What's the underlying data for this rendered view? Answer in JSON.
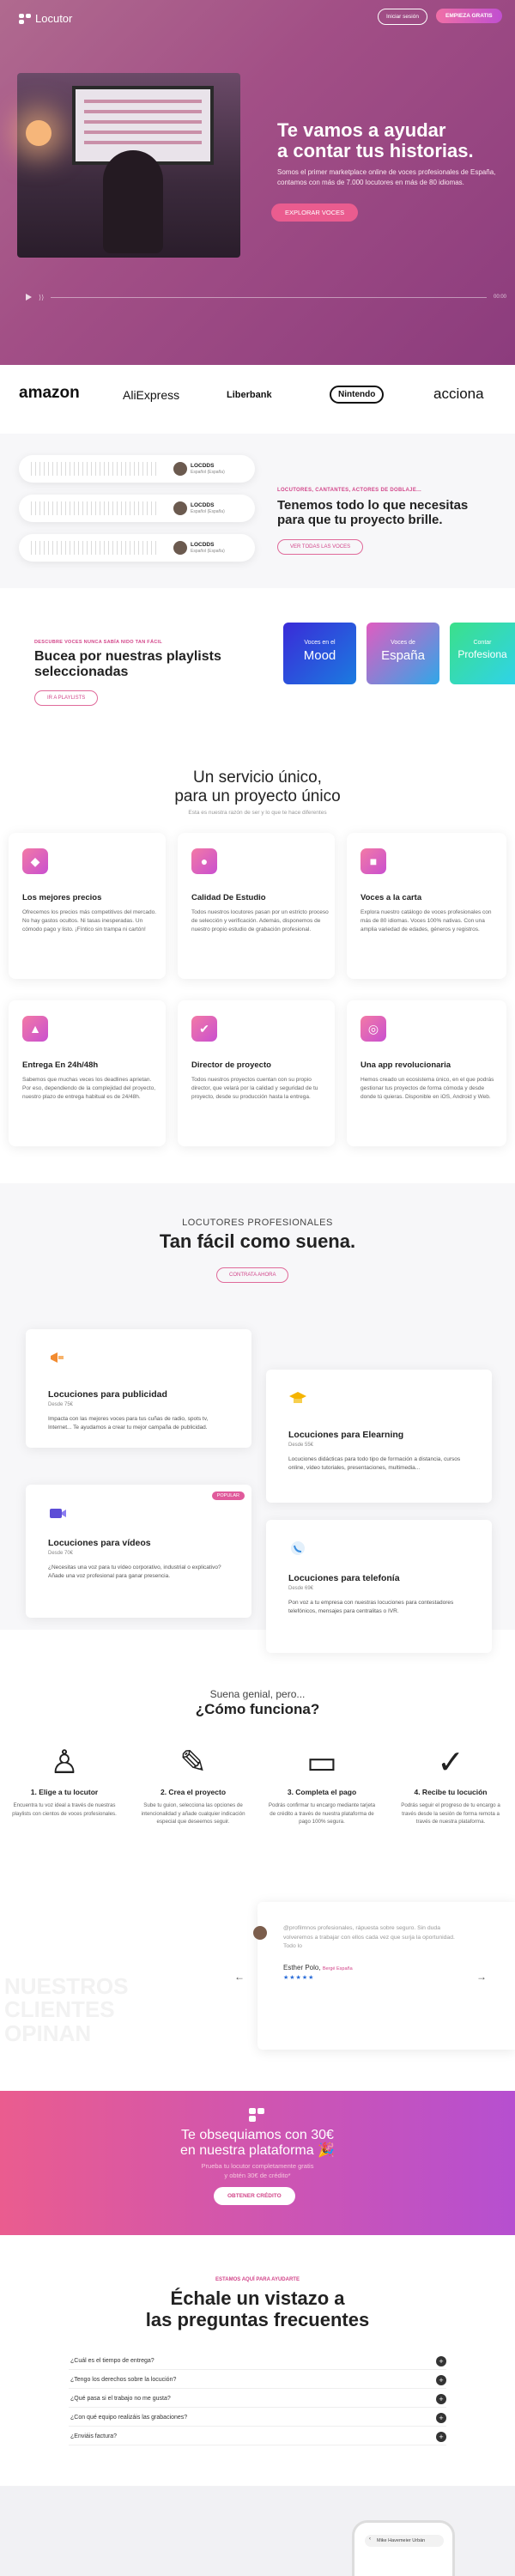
{
  "header": {
    "brand": "Locutor",
    "login_label": "Iniciar sesión",
    "cta_label": "EMPIEZA GRATIS"
  },
  "hero": {
    "title_line1": "Te vamos a ayudar",
    "title_line2": "a contar tus historias.",
    "subtitle_line1": "Somos el primer marketplace online de voces profesionales de España,",
    "subtitle_line2": "contamos con más de 7.000 locutores en más de 80 idiomas.",
    "cta_label": "EXPLORAR VOCES"
  },
  "brands": [
    "amazon",
    "AliExpress",
    "Liberbank",
    "Nintendo",
    "acciona"
  ],
  "voices": [
    {
      "name": "LOCDDS",
      "desc": "Español (España)"
    },
    {
      "name": "LOCDDS",
      "desc": "Español (España)"
    },
    {
      "name": "LOCDDS",
      "desc": "Español (España)"
    }
  ],
  "voices_section": {
    "eyebrow": "LOCUTORES, CANTANTES, ACTORES DE DOBLAJE...",
    "title_line1": "Tenemos todo lo que necesitas",
    "title_line2": "para que tu proyecto brille.",
    "button_label": "VER TODAS LAS VOCES"
  },
  "playlists_section": {
    "eyebrow": "DESCUBRE VOCES NUNCA SABÍA NIDO TAN FÁCIL",
    "title_line1": "Bucea por nuestras playlists",
    "title_line2": "seleccionadas",
    "button_label": "IR A PLAYLISTS",
    "playlists": [
      {
        "small": "Voces en el",
        "big": "Mood",
        "color1": "#3a2bd8",
        "color2": "#1b7be0"
      },
      {
        "small": "Voces de",
        "big": "España",
        "color1": "#e05cc1",
        "color2": "#2fa7e8"
      },
      {
        "small": "Contar",
        "big": "Profesiona",
        "color1": "#3be08a",
        "color2": "#2fd3e8"
      }
    ]
  },
  "services": {
    "title_line1": "Un servicio único,",
    "title_line2": "para un proyecto único",
    "subtitle": "Esta es nuestra razón de ser y lo que te hace diferentes",
    "cards": [
      {
        "icon": "tag-icon",
        "glyph": "◆",
        "title": "Los mejores precios",
        "desc": "Ofrecemos los precios más competitivos del mercado. No hay gastos ocultos. Ni tasas inesperadas. Un cómodo pago y listo. ¡Fíntico sin trampa ni cartón!"
      },
      {
        "icon": "microphone-icon",
        "glyph": "●",
        "title": "Calidad De Estudio",
        "desc": "Todos nuestros locutores pasan por un estricto proceso de selección y verificación. Además, disponemos de nuestro propio estudio de grabación profesional."
      },
      {
        "icon": "clipboard-icon",
        "glyph": "■",
        "title": "Voces a la carta",
        "desc": "Explora nuestro catálogo de voces profesionales con más de 80 idiomas. Voces 100% nativas. Con una amplia variedad de edades, géneros y registros."
      },
      {
        "icon": "rocket-icon",
        "glyph": "▲",
        "title": "Entrega En 24h/48h",
        "desc": "Sabemos que muchas veces los deadlines aprietan. Por eso, dependiendo de la complejidad del proyecto, nuestro plazo de entrega habitual es de 24/48h."
      },
      {
        "icon": "director-icon",
        "glyph": "✔",
        "title": "Director de proyecto",
        "desc": "Todos nuestros proyectos cuentan con su propio director, que velará por la calidad y seguridad de tu proyecto, desde su producción hasta la entrega."
      },
      {
        "icon": "app-icon",
        "glyph": "◎",
        "title": "Una app revolucionaria",
        "desc": "Hemos creado un ecosistema único, en el que podrás gestionar tus proyectos de forma cómoda y desde donde tú quieras. Disponible en iOS, Android y Web."
      }
    ]
  },
  "products": {
    "eyebrow": "LOCUTORES PROFESIONALES",
    "title": "Tan fácil como suena.",
    "button_label": "CONTRATA AHORA",
    "badge": "POPULAR",
    "items": [
      {
        "title": "Locuciones para publicidad",
        "from": "Desde 75€",
        "desc": "Impacta con las mejores voces para tus cuñas de radio, spots tv, Internet... Te ayudamos a crear tu mejor campaña de publicidad."
      },
      {
        "title": "Locuciones para Elearning",
        "from": "Desde 55€",
        "desc": "Locuciones didácticas para todo tipo de formación a distancia, cursos online, vídeo tutoriales, presentaciones, multimedia..."
      },
      {
        "title": "Locuciones para vídeos",
        "from": "Desde 70€",
        "desc": "¿Necesitas una voz para tu vídeo corporativo, industrial o explicativo? Añade una voz profesional para ganar presencia."
      },
      {
        "title": "Locuciones para telefonía",
        "from": "Desde 69€",
        "desc": "Pon voz a tu empresa con nuestras locuciones para contestadores telefónicos, mensajes para centralitas o IVR."
      }
    ]
  },
  "how": {
    "pre": "Suena genial, pero...",
    "title": "¿Cómo funciona?",
    "steps": [
      {
        "icon": "user-icon",
        "glyph": "♙",
        "title": "1. Elige a tu locutor",
        "desc": "Encuentra tu voz ideal a través de nuestras playlists con cientos de voces profesionales."
      },
      {
        "icon": "edit-icon",
        "glyph": "✎",
        "title": "2. Crea el proyecto",
        "desc": "Sube tu guion, selecciona las opciones de intencionalidad y añade cualquier indicación especial que deseemos seguir."
      },
      {
        "icon": "card-icon",
        "glyph": "▭",
        "title": "3. Completa el pago",
        "desc": "Podrás confirmar tu encargo mediante tarjeta de crédito a través de nuestra plataforma de pago 100% segura."
      },
      {
        "icon": "check-circle-icon",
        "glyph": "✓",
        "title": "4. Recibe tu locución",
        "desc": "Podrás seguir el progreso de tu encargo a través desde la sesión de forma remota a través de nuestra plataforma."
      }
    ]
  },
  "testimonials": {
    "watermark_line1": "NUESTROS",
    "watermark_line2": "CLIENTES",
    "watermark_line3": "OPINAN",
    "quote": "@profilmnos profesionales, rápuesta sobre seguro. Sin duda volveremos a trabajar con ellos cada vez que surja la oportunidad. Todo lo",
    "author": "Esther Polo,",
    "author_role": "Bergé España",
    "stars": "★★★★★"
  },
  "promo": {
    "title_line1": "Te obsequiamos con 30€",
    "title_line2": "en nuestra plataforma 🎉",
    "sub_line1": "Prueba tu locutor completamente gratis",
    "sub_line2": "y obtén 30€ de crédito*",
    "button_label": "OBTENER CRÉDITO"
  },
  "faq": {
    "eyebrow": "ESTAMOS AQUÍ PARA AYUDARTE",
    "title_line1": "Échale un vistazo a",
    "title_line2": "las preguntas frecuentes",
    "items": [
      "¿Cuál es el tiempo de entrega?",
      "¿Tengo los derechos sobre la locución?",
      "¿Qué pasa si el trabajo no me gusta?",
      "¿Con qué equipo realizáis las grabaciones?",
      "¿Enviáis factura?"
    ]
  },
  "app": {
    "search_placeholder": "Mike Havemeier Urbán"
  }
}
